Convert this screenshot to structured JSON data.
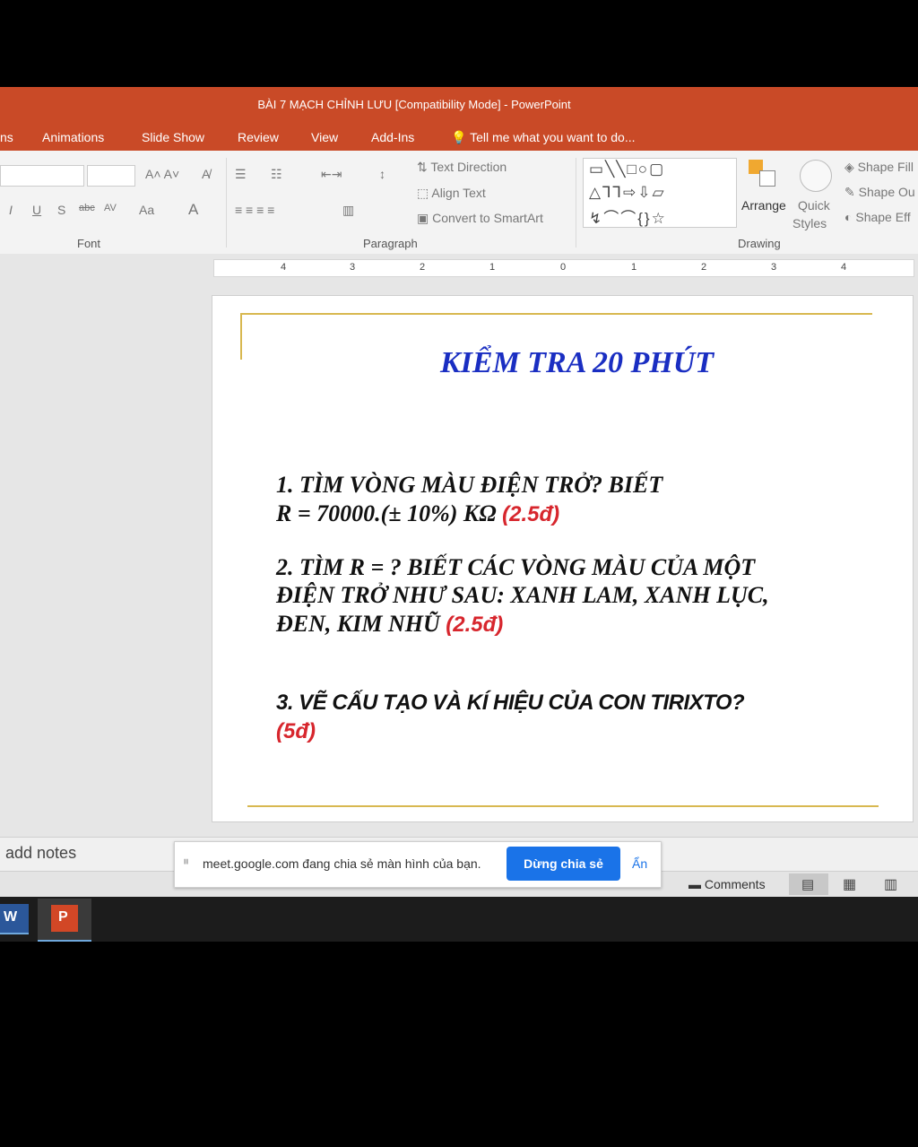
{
  "window": {
    "title": "BÀI 7 MẠCH CHỈNH LƯU [Compatibility Mode] - PowerPoint"
  },
  "tabs": [
    {
      "label": "ns"
    },
    {
      "label": "Animations"
    },
    {
      "label": "Slide Show"
    },
    {
      "label": "Review"
    },
    {
      "label": "View"
    },
    {
      "label": "Add-Ins"
    },
    {
      "label": "Tell me what you want to do..."
    }
  ],
  "ribbon": {
    "groups": {
      "font": "Font",
      "paragraph": "Paragraph",
      "drawing": "Drawing"
    },
    "paragraph": {
      "text_direction": "Text Direction",
      "align_text": "Align Text",
      "convert_smartart": "Convert to SmartArt"
    },
    "drawing": {
      "arrange": "Arrange",
      "quick": "Quick",
      "styles": "Styles",
      "shape_fill": "Shape Fill",
      "shape_outline": "Shape Ou",
      "shape_effects": "Shape Eff"
    }
  },
  "ruler": {
    "ticks": [
      "4",
      "3",
      "2",
      "1",
      "0",
      "1",
      "2",
      "3",
      "4"
    ]
  },
  "slide": {
    "title": "KIỂM TRA 20 PHÚT",
    "q1_line1": "1.   TÌM VÒNG MÀU ĐIỆN TRỞ?  BIẾT",
    "q1_line2": "R = 70000.(± 10%) KΩ  ",
    "q1_points": "(2.5đ)",
    "q2_line1": "2. TÌM R = ? BIẾT CÁC VÒNG MÀU CỦA MỘT",
    "q2_line2": "ĐIỆN TRỞ NHƯ SAU:  XANH LAM, XANH LỤC,",
    "q2_line3": "ĐEN, KIM NHŨ  ",
    "q2_points": "(2.5đ)",
    "q3_line1": "3. VẼ CẤU TẠO VÀ KÍ HIỆU CỦA CON TIRIXTO?",
    "q3_points": "(5đ)"
  },
  "notes": {
    "placeholder": "add notes"
  },
  "share_banner": {
    "message": "meet.google.com đang chia sẻ màn hình của bạn.",
    "stop_label": "Dừng chia sẻ",
    "hide_label": "Ẩn"
  },
  "status": {
    "comments_label": "Comments"
  },
  "taskbar": {
    "word_label": "W",
    "ppt_label": "P"
  },
  "colors": {
    "titlebar": "#c94a27",
    "title_text": "#1a2ec2",
    "points": "#d7262d",
    "accent_line": "#d8b850",
    "share_button": "#1a73e8"
  }
}
